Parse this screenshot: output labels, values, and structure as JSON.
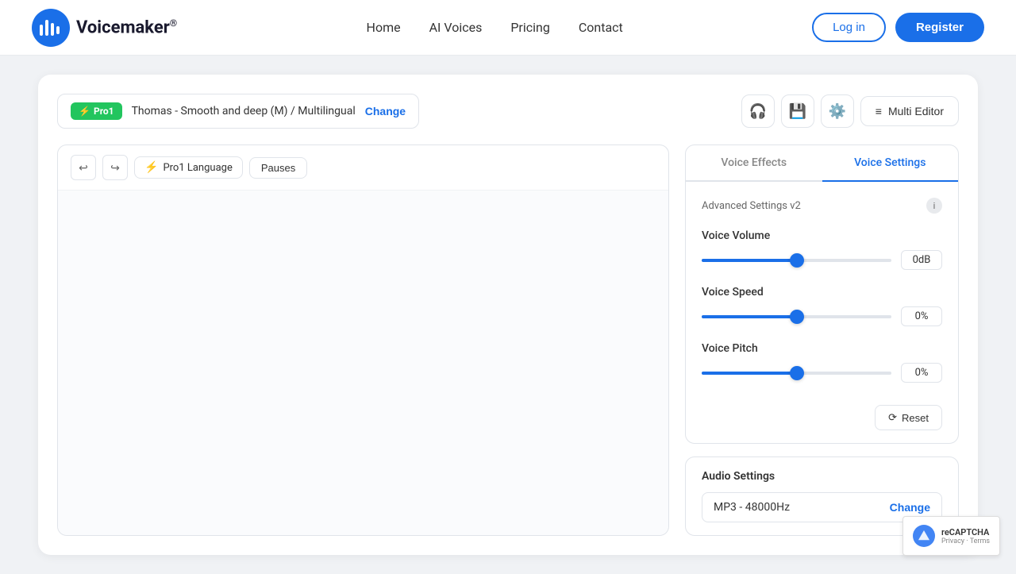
{
  "header": {
    "logo_text": "Voicemaker",
    "logo_sup": "®",
    "nav": {
      "home": "Home",
      "ai_voices": "AI Voices",
      "pricing": "Pricing",
      "contact": "Contact"
    },
    "login_label": "Log in",
    "register_label": "Register"
  },
  "editor": {
    "pro1_badge": "Pro1",
    "voice_name": "Thomas - Smooth and deep (M) / Multilingual",
    "change_label": "Change",
    "multi_editor_label": "Multi Editor",
    "toolbar": {
      "undo": "↩",
      "redo": "↪",
      "pro1_language": "Pro1 Language",
      "pauses": "Pauses"
    }
  },
  "voice_effects_tab": "Voice Effects",
  "voice_settings_tab": "Voice Settings",
  "settings": {
    "advanced_label": "Advanced Settings v2",
    "volume": {
      "label": "Voice Volume",
      "value": "0dB",
      "percent": 50
    },
    "speed": {
      "label": "Voice Speed",
      "value": "0%",
      "percent": 50
    },
    "pitch": {
      "label": "Voice Pitch",
      "value": "0%",
      "percent": 50
    },
    "reset_label": "Reset"
  },
  "audio": {
    "title": "Audio Settings",
    "format": "MP3 - 48000Hz",
    "change_label": "Change"
  }
}
